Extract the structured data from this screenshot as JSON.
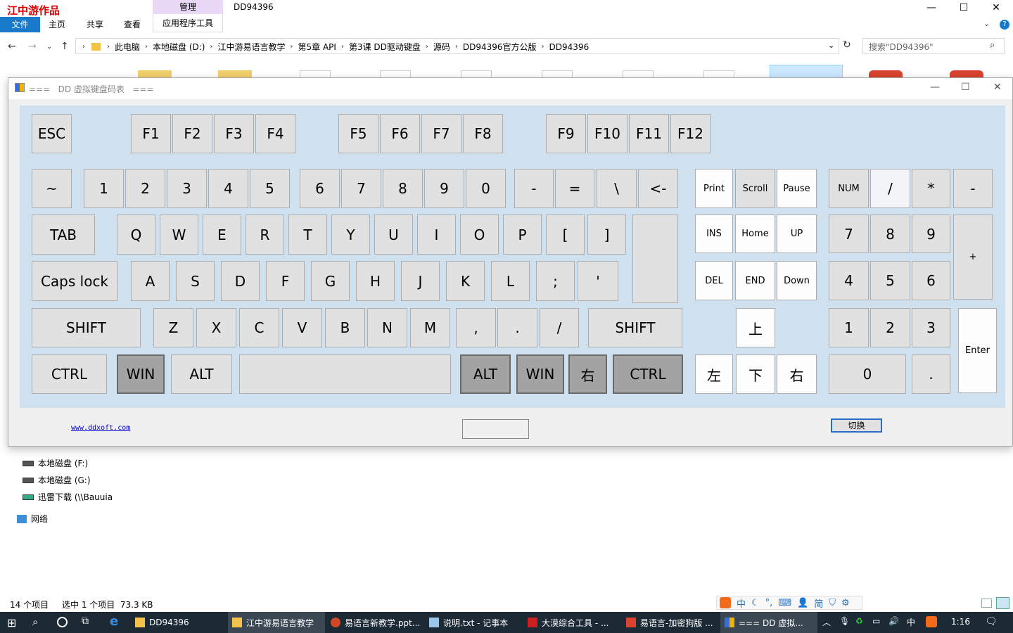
{
  "explorer": {
    "watermark": "江中游作品",
    "title": "DD94396",
    "context_tab": "管理",
    "tabs": [
      "文件",
      "主页",
      "共享",
      "查看",
      "应用程序工具"
    ],
    "window_controls": {
      "minimize": "—",
      "maximize": "☐",
      "close": "✕"
    },
    "breadcrumb": [
      "此电脑",
      "本地磁盘 (D:)",
      "江中游易语言教学",
      "第5章 API",
      "第3课 DD驱动键盘",
      "源码",
      "DD94396官方公版",
      "DD94396"
    ],
    "search_placeholder": "搜索\"DD94396\"",
    "nav_pane": [
      "本地磁盘 (F:)",
      "本地磁盘 (G:)",
      "迅雷下载 (\\\\Bauuia",
      "网络"
    ],
    "status": {
      "count": "14 个项目",
      "selected": "选中 1 个项目  73.3 KB"
    },
    "ime": [
      "中",
      "简"
    ]
  },
  "dialog": {
    "title": "===   DD 虚拟键盘码表   ===",
    "link": "www.ddxoft.com",
    "switch_button": "切换",
    "input_value": ""
  },
  "keys": [
    {
      "label": "ESC",
      "style": "normal"
    },
    {
      "label": "F1",
      "style": "normal"
    },
    {
      "label": "F2",
      "style": "normal"
    },
    {
      "label": "F3",
      "style": "normal"
    },
    {
      "label": "F4",
      "style": "normal"
    },
    {
      "label": "F5",
      "style": "normal"
    },
    {
      "label": "F6",
      "style": "normal"
    },
    {
      "label": "F7",
      "style": "normal"
    },
    {
      "label": "F8",
      "style": "normal"
    },
    {
      "label": "F9",
      "style": "normal"
    },
    {
      "label": "F10",
      "style": "normal"
    },
    {
      "label": "F11",
      "style": "normal"
    },
    {
      "label": "F12",
      "style": "normal"
    },
    {
      "label": "~",
      "style": "normal"
    },
    {
      "label": "1",
      "style": "normal"
    },
    {
      "label": "2",
      "style": "normal"
    },
    {
      "label": "3",
      "style": "normal"
    },
    {
      "label": "4",
      "style": "normal"
    },
    {
      "label": "5",
      "style": "normal"
    },
    {
      "label": "6",
      "style": "normal"
    },
    {
      "label": "7",
      "style": "normal"
    },
    {
      "label": "8",
      "style": "normal"
    },
    {
      "label": "9",
      "style": "normal"
    },
    {
      "label": "0",
      "style": "normal"
    },
    {
      "label": "-",
      "style": "normal"
    },
    {
      "label": "=",
      "style": "normal"
    },
    {
      "label": "\\",
      "style": "normal"
    },
    {
      "label": "<-",
      "style": "normal"
    },
    {
      "label": "Print",
      "style": "white-sm"
    },
    {
      "label": "Scroll",
      "style": "normal-sm"
    },
    {
      "label": "Pause",
      "style": "white-sm"
    },
    {
      "label": "NUM",
      "style": "normal-sm"
    },
    {
      "label": "/",
      "style": "light"
    },
    {
      "label": "*",
      "style": "normal"
    },
    {
      "label": "-",
      "style": "normal"
    },
    {
      "label": "TAB",
      "style": "normal"
    },
    {
      "label": "Q",
      "style": "normal"
    },
    {
      "label": "W",
      "style": "normal"
    },
    {
      "label": "E",
      "style": "normal"
    },
    {
      "label": "R",
      "style": "normal"
    },
    {
      "label": "T",
      "style": "normal"
    },
    {
      "label": "Y",
      "style": "normal"
    },
    {
      "label": "U",
      "style": "normal"
    },
    {
      "label": "I",
      "style": "normal"
    },
    {
      "label": "O",
      "style": "normal"
    },
    {
      "label": "P",
      "style": "normal"
    },
    {
      "label": "[",
      "style": "normal"
    },
    {
      "label": "]",
      "style": "normal"
    },
    {
      "label": "",
      "style": "normal"
    },
    {
      "label": "INS",
      "style": "white-sm"
    },
    {
      "label": "Home",
      "style": "white-sm"
    },
    {
      "label": "UP",
      "style": "white-sm"
    },
    {
      "label": "7",
      "style": "normal"
    },
    {
      "label": "8",
      "style": "normal"
    },
    {
      "label": "9",
      "style": "normal"
    },
    {
      "label": "+",
      "style": "normal-sm"
    },
    {
      "label": "Caps lock",
      "style": "normal"
    },
    {
      "label": "A",
      "style": "normal"
    },
    {
      "label": "S",
      "style": "normal"
    },
    {
      "label": "D",
      "style": "normal"
    },
    {
      "label": "F",
      "style": "normal"
    },
    {
      "label": "G",
      "style": "normal"
    },
    {
      "label": "H",
      "style": "normal"
    },
    {
      "label": "J",
      "style": "normal"
    },
    {
      "label": "K",
      "style": "normal"
    },
    {
      "label": "L",
      "style": "normal"
    },
    {
      "label": ";",
      "style": "normal"
    },
    {
      "label": "'",
      "style": "normal"
    },
    {
      "label": "DEL",
      "style": "white-sm"
    },
    {
      "label": "END",
      "style": "white-sm"
    },
    {
      "label": "Down",
      "style": "white-sm"
    },
    {
      "label": "4",
      "style": "normal"
    },
    {
      "label": "5",
      "style": "normal"
    },
    {
      "label": "6",
      "style": "normal"
    },
    {
      "label": "SHIFT",
      "style": "normal"
    },
    {
      "label": "Z",
      "style": "normal"
    },
    {
      "label": "X",
      "style": "normal"
    },
    {
      "label": "C",
      "style": "normal"
    },
    {
      "label": "V",
      "style": "normal"
    },
    {
      "label": "B",
      "style": "normal"
    },
    {
      "label": "N",
      "style": "normal"
    },
    {
      "label": "M",
      "style": "normal"
    },
    {
      "label": ",",
      "style": "normal"
    },
    {
      "label": ".",
      "style": "normal"
    },
    {
      "label": "/",
      "style": "normal"
    },
    {
      "label": "SHIFT",
      "style": "normal"
    },
    {
      "label": "上",
      "style": "white"
    },
    {
      "label": "1",
      "style": "normal"
    },
    {
      "label": "2",
      "style": "normal"
    },
    {
      "label": "3",
      "style": "normal"
    },
    {
      "label": "Enter",
      "style": "white-sm"
    },
    {
      "label": "CTRL",
      "style": "normal"
    },
    {
      "label": "WIN",
      "style": "dark"
    },
    {
      "label": "ALT",
      "style": "normal"
    },
    {
      "label": "",
      "style": "normal"
    },
    {
      "label": "ALT",
      "style": "dark"
    },
    {
      "label": "WIN",
      "style": "dark"
    },
    {
      "label": "右",
      "style": "dark"
    },
    {
      "label": "CTRL",
      "style": "dark"
    },
    {
      "label": "左",
      "style": "white"
    },
    {
      "label": "下",
      "style": "white"
    },
    {
      "label": "右",
      "style": "white"
    },
    {
      "label": "0",
      "style": "normal"
    },
    {
      "label": ".",
      "style": "normal"
    }
  ],
  "taskbar": {
    "items": [
      "DD94396",
      "江中游易语言教学",
      "易语言新教学.ppt...",
      "说明.txt - 记事本",
      "大漠综合工具 - ...",
      "易语言-加密狗版 ...",
      "=== DD 虚拟..."
    ],
    "clock": "1:16",
    "ime": "中"
  },
  "colors": {
    "accent": "#1979ca",
    "keyboard_bg": "#cfe0ef",
    "key_bg": "#e1e1e1",
    "key_dark": "#a3a3a3",
    "taskbar": "#1c2a36"
  }
}
